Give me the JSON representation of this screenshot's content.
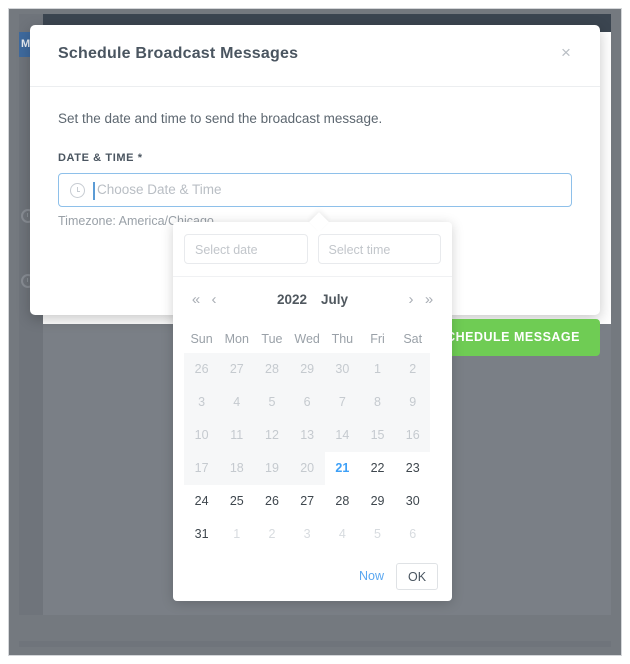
{
  "background_page": {
    "sidebar_active_label": "M",
    "accent_navy": "#3b4550",
    "overlay_gray": "#74797f"
  },
  "modal": {
    "title": "Schedule Broadcast Messages",
    "close_icon": "close-icon",
    "description": "Set the date and time to send the broadcast message.",
    "field_label": "DATE & TIME *",
    "datetime_input": {
      "icon": "clock-icon",
      "value": "",
      "placeholder": "Choose Date & Time"
    },
    "timezone_note": "Timezone: America/Chicago",
    "submit_label": "SCHEDULE MESSAGE",
    "submit_color": "#6fcc54"
  },
  "picker": {
    "date_input": {
      "value": "",
      "placeholder": "Select date"
    },
    "time_input": {
      "value": "",
      "placeholder": "Select time"
    },
    "nav": {
      "prev_year_icon": "«",
      "prev_month_icon": "‹",
      "year": "2022",
      "month": "July",
      "next_month_icon": "›",
      "next_year_icon": "»"
    },
    "weekdays": [
      "Sun",
      "Mon",
      "Tue",
      "Wed",
      "Thu",
      "Fri",
      "Sat"
    ],
    "weeks": [
      [
        {
          "d": "26",
          "state": "disabled"
        },
        {
          "d": "27",
          "state": "disabled"
        },
        {
          "d": "28",
          "state": "disabled"
        },
        {
          "d": "29",
          "state": "disabled"
        },
        {
          "d": "30",
          "state": "disabled"
        },
        {
          "d": "1",
          "state": "disabled"
        },
        {
          "d": "2",
          "state": "disabled"
        }
      ],
      [
        {
          "d": "3",
          "state": "disabled"
        },
        {
          "d": "4",
          "state": "disabled"
        },
        {
          "d": "5",
          "state": "disabled"
        },
        {
          "d": "6",
          "state": "disabled"
        },
        {
          "d": "7",
          "state": "disabled"
        },
        {
          "d": "8",
          "state": "disabled"
        },
        {
          "d": "9",
          "state": "disabled"
        }
      ],
      [
        {
          "d": "10",
          "state": "disabled"
        },
        {
          "d": "11",
          "state": "disabled"
        },
        {
          "d": "12",
          "state": "disabled"
        },
        {
          "d": "13",
          "state": "disabled"
        },
        {
          "d": "14",
          "state": "disabled"
        },
        {
          "d": "15",
          "state": "disabled"
        },
        {
          "d": "16",
          "state": "disabled"
        }
      ],
      [
        {
          "d": "17",
          "state": "disabled"
        },
        {
          "d": "18",
          "state": "disabled"
        },
        {
          "d": "19",
          "state": "disabled"
        },
        {
          "d": "20",
          "state": "disabled"
        },
        {
          "d": "21",
          "state": "today"
        },
        {
          "d": "22",
          "state": "enabled"
        },
        {
          "d": "23",
          "state": "enabled"
        }
      ],
      [
        {
          "d": "24",
          "state": "enabled"
        },
        {
          "d": "25",
          "state": "enabled"
        },
        {
          "d": "26",
          "state": "enabled"
        },
        {
          "d": "27",
          "state": "enabled"
        },
        {
          "d": "28",
          "state": "enabled"
        },
        {
          "d": "29",
          "state": "enabled"
        },
        {
          "d": "30",
          "state": "enabled"
        }
      ],
      [
        {
          "d": "31",
          "state": "enabled"
        },
        {
          "d": "1",
          "state": "other"
        },
        {
          "d": "2",
          "state": "other"
        },
        {
          "d": "3",
          "state": "other"
        },
        {
          "d": "4",
          "state": "other"
        },
        {
          "d": "5",
          "state": "other"
        },
        {
          "d": "6",
          "state": "other"
        }
      ]
    ],
    "today_color": "#3ea0f7",
    "footer": {
      "now_label": "Now",
      "ok_label": "OK"
    }
  }
}
